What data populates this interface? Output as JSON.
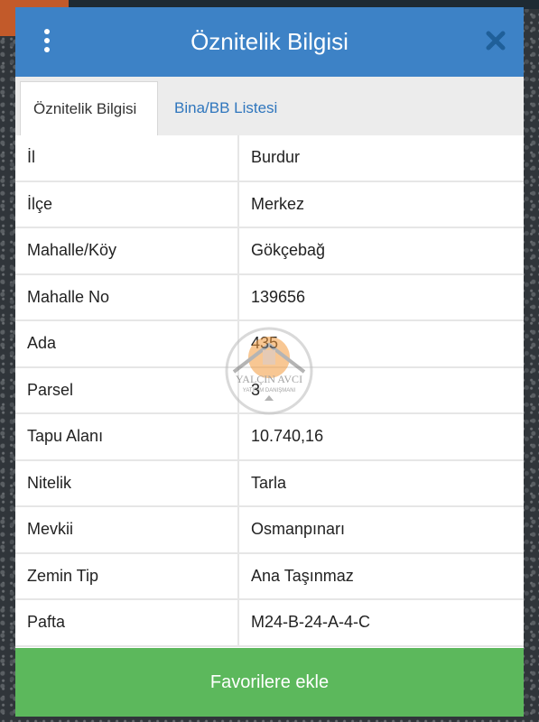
{
  "dialog": {
    "title": "Öznitelik Bilgisi",
    "menu_icon": "kebab-menu-icon",
    "close_icon": "close-icon"
  },
  "tabs": [
    {
      "label": "Öznitelik Bilgisi",
      "active": true
    },
    {
      "label": "Bina/BB Listesi",
      "active": false
    }
  ],
  "attributes": [
    {
      "key": "İl",
      "value": "Burdur"
    },
    {
      "key": "İlçe",
      "value": "Merkez"
    },
    {
      "key": "Mahalle/Köy",
      "value": "Gökçebağ"
    },
    {
      "key": "Mahalle No",
      "value": "139656"
    },
    {
      "key": "Ada",
      "value": "435"
    },
    {
      "key": "Parsel",
      "value": "3"
    },
    {
      "key": "Tapu Alanı",
      "value": "10.740,16"
    },
    {
      "key": "Nitelik",
      "value": "Tarla"
    },
    {
      "key": "Mevkii",
      "value": "Osmanpınarı"
    },
    {
      "key": "Zemin Tip",
      "value": "Ana Taşınmaz"
    },
    {
      "key": "Pafta",
      "value": "M24-B-24-A-4-C"
    }
  ],
  "footer": {
    "button_label": "Favorilere ekle"
  },
  "watermark": {
    "name": "YALÇIN AVCI",
    "subtitle": "YATIRIM DANIŞMANI"
  },
  "colors": {
    "header": "#3d82c6",
    "button": "#5cb85c",
    "tab_link": "#2f76bd"
  }
}
